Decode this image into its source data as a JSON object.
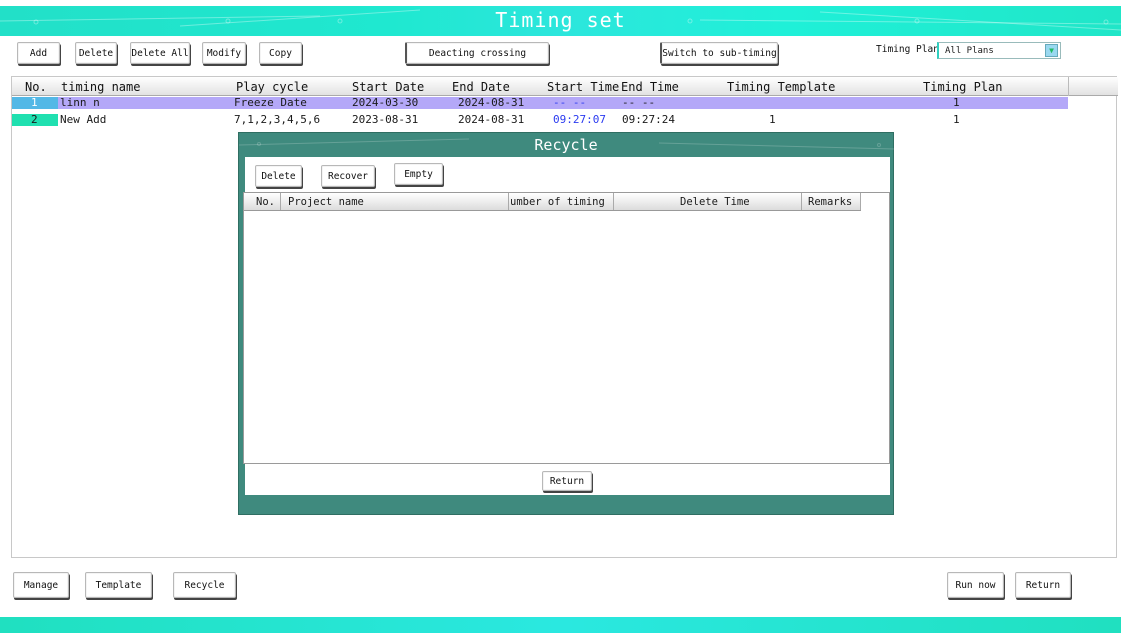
{
  "title": "Timing set",
  "toolbar": {
    "add": "Add",
    "delete": "Delete",
    "delete_all": "Delete All",
    "modify": "Modify",
    "copy": "Copy",
    "deacting": "Deacting crossing",
    "switch": "Switch to sub-timing",
    "plan_label": "Timing Plan",
    "plan_value": "All Plans"
  },
  "table": {
    "columns": [
      "No.",
      "timing name",
      "Play cycle",
      "Start Date",
      "End Date",
      "Start Time",
      "End Time",
      "Timing Template",
      "Timing Plan"
    ],
    "rows": [
      {
        "no": "1",
        "name": "linn n",
        "cycle": "Freeze Date",
        "start_date": "2024-03-30",
        "end_date": "2024-08-31",
        "start_time": "-- --",
        "end_time": "-- --",
        "template": "",
        "plan": "1"
      },
      {
        "no": "2",
        "name": "New Add",
        "cycle": "7,1,2,3,4,5,6",
        "start_date": "2023-08-31",
        "end_date": "2024-08-31",
        "start_time": "09:27:07",
        "end_time": "09:27:24",
        "template": "1",
        "plan": "1"
      }
    ]
  },
  "recycle": {
    "title": "Recycle",
    "delete": "Delete",
    "recover": "Recover",
    "empty": "Empty",
    "columns": [
      "No.",
      "Project name",
      "umber of timing point",
      "Delete Time",
      "Remarks"
    ],
    "return": "Return"
  },
  "footer": {
    "manage": "Manage",
    "template": "Template",
    "recycle": "Recycle",
    "run_now": "Run now",
    "return": "Return"
  },
  "colors": {
    "accent": "#22e0c8",
    "dialog": "#3f8a7e",
    "selected_row": "#b4a8f8",
    "blue_text": "#2a3af0"
  }
}
